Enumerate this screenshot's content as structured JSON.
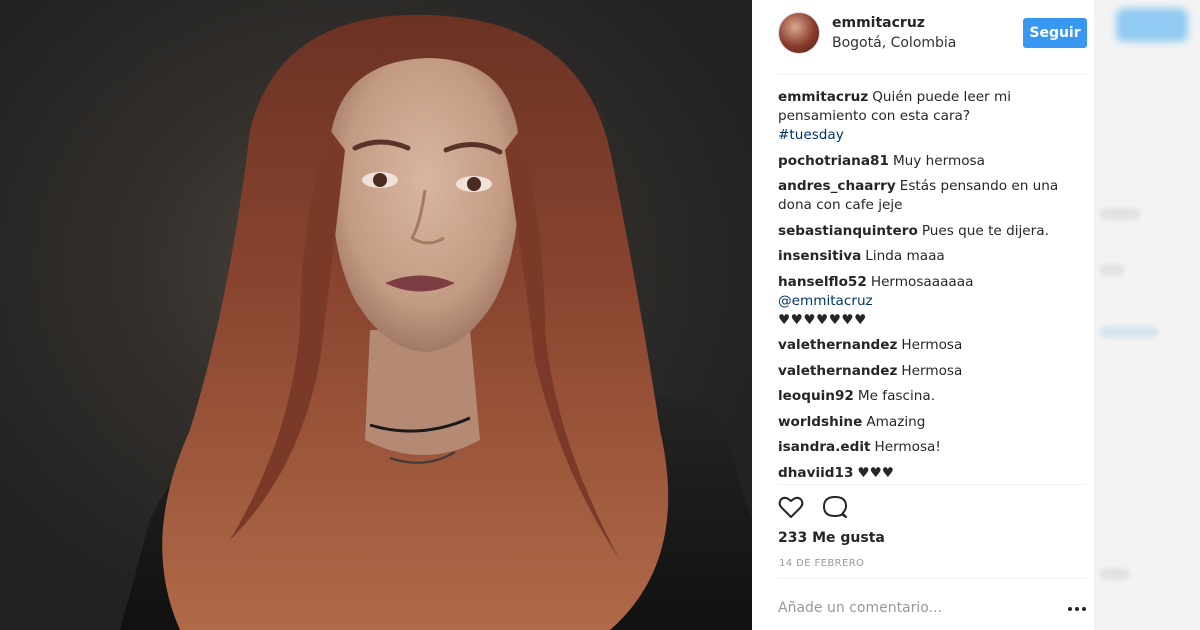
{
  "post": {
    "username": "emmitacruz",
    "location": "Bogotá, Colombia",
    "follow_label": "Seguir",
    "caption": {
      "username": "emmitacruz",
      "text": "Quién puede leer mi pensamiento con esta cara?",
      "hashtag": "#tuesday"
    },
    "comments": [
      {
        "username": "pochotriana81",
        "text": "Muy hermosa"
      },
      {
        "username": "andres_chaarry",
        "text": "Estás pensando en una dona con cafe jeje"
      },
      {
        "username": "sebastianquintero",
        "text": "Pues que te dijera."
      },
      {
        "username": "insensitiva",
        "text": "Linda maaa"
      },
      {
        "username": "hanselflo52",
        "text": "Hermosaaaaaa",
        "mention": "@emmitacruz",
        "extra": "♥♥♥♥♥♥♥"
      },
      {
        "username": "valethernandez",
        "text": "Hermosa"
      },
      {
        "username": "valethernandez",
        "text": "Hermosa"
      },
      {
        "username": "leoquin92",
        "text": "Me fascina."
      },
      {
        "username": "worldshine",
        "text": "Amazing"
      },
      {
        "username": "isandra.edit",
        "text": "Hermosa!"
      },
      {
        "username": "dhaviid13",
        "text": "♥♥♥"
      }
    ],
    "likes": "233 Me gusta",
    "date": "14 DE FEBRERO",
    "comment_placeholder": "Añade un comentario...",
    "icons": {
      "like": "heart-icon",
      "comment": "comment-bubble-icon",
      "more": "more-options-icon"
    },
    "colors": {
      "follow_button": "#3897f0",
      "link": "#003569",
      "text": "#262626",
      "muted": "#999999"
    }
  }
}
